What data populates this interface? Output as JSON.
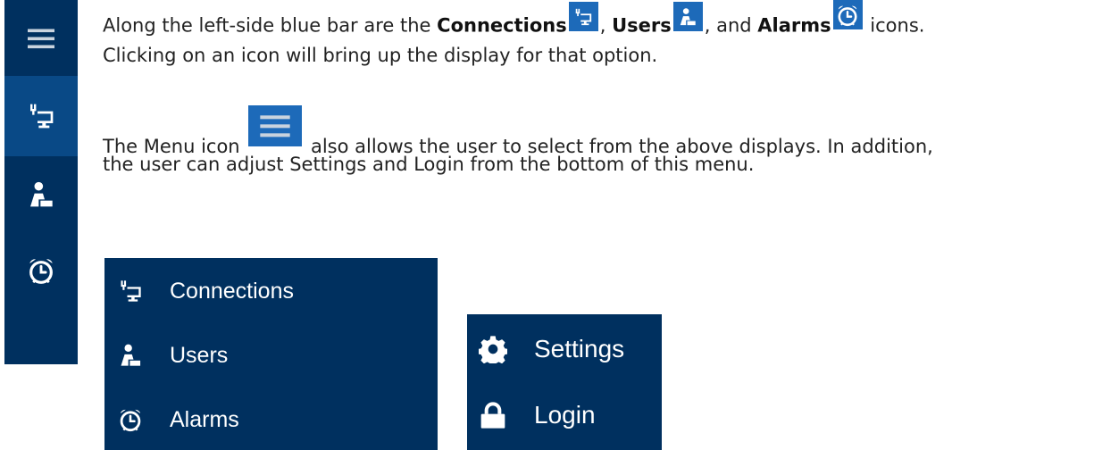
{
  "paragraph1": {
    "t1": "Along the left-side blue bar are the ",
    "connections": "Connections",
    "sep1": ", ",
    "users": "Users",
    "sep2": ",  and ",
    "alarms": "Alarms",
    "t2": " icons.",
    "line2": "Clicking on an icon will bring up the display for that option."
  },
  "paragraph2": {
    "t1": "The Menu icon ",
    "t2": " also allows the user to select from the above displays.  In addition,",
    "line2": "the user can adjust Settings and Login from the bottom of this menu."
  },
  "rail": {
    "items": [
      {
        "icon": "menu-icon"
      },
      {
        "icon": "connections-icon"
      },
      {
        "icon": "users-icon"
      },
      {
        "icon": "alarm-clock-icon"
      }
    ]
  },
  "menu_panel": {
    "items": [
      {
        "label": "Connections",
        "icon": "connections-icon"
      },
      {
        "label": "Users",
        "icon": "users-icon"
      },
      {
        "label": "Alarms",
        "icon": "alarm-clock-icon"
      }
    ]
  },
  "bottom_panel": {
    "items": [
      {
        "label": "Settings",
        "icon": "gear-icon"
      },
      {
        "label": "Login",
        "icon": "lock-icon"
      }
    ]
  },
  "colors": {
    "panel_navy": "#00305f",
    "active_blue": "#094986",
    "icon_blue": "#1d6ab9",
    "text": "#222222"
  }
}
